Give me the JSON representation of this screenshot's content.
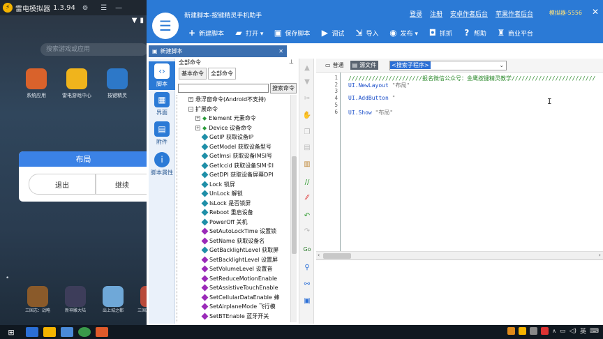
{
  "emulator": {
    "title": "雷电模拟器",
    "version": "1.3.94",
    "search_placeholder": "搜索游戏或应用",
    "apps": [
      {
        "label": "系统应用",
        "color": "#d9622b"
      },
      {
        "label": "雷电游戏中心",
        "color": "#f0b41c"
      },
      {
        "label": "按键精灵",
        "color": "#2d78c8"
      }
    ],
    "dialog": {
      "title": "布局",
      "left_button": "退出",
      "right_button": "继续"
    },
    "dock": [
      {
        "label": "三国志：战略",
        "color": "#8a5a2a"
      },
      {
        "label": "新神雕大陆",
        "color": "#3d3d5a"
      },
      {
        "label": "出上城之都",
        "color": "#6fa8d8"
      },
      {
        "label": "三国志:乱世之群大",
        "color": "#b84a3a"
      }
    ]
  },
  "ide": {
    "title": "新建脚本-按键精灵手机助手",
    "links": [
      "登录",
      "注册",
      "安卓作者后台",
      "苹果作者后台"
    ],
    "user": "模拟器-5556",
    "toolbar": [
      {
        "icon": "plus-icon",
        "glyph": "+",
        "label": "新建脚本"
      },
      {
        "icon": "folder-icon",
        "glyph": "▰",
        "label": "打开 ▾"
      },
      {
        "icon": "save-icon",
        "glyph": "▣",
        "label": "保存脚本"
      },
      {
        "icon": "play-icon",
        "glyph": "▶",
        "label": "调试"
      },
      {
        "icon": "import-icon",
        "glyph": "⇲",
        "label": "导入"
      },
      {
        "icon": "publish-icon",
        "glyph": "◉",
        "label": "发布 ▾"
      },
      {
        "icon": "camera-icon",
        "glyph": "◘",
        "label": "抓抓"
      },
      {
        "icon": "help-icon",
        "glyph": "?",
        "label": "帮助"
      },
      {
        "icon": "shop-icon",
        "glyph": "♜",
        "label": "商业平台"
      }
    ],
    "tab": "新建脚本",
    "side_items": [
      {
        "label": "脚本",
        "icon": "script-icon",
        "color": "#2b7ad6"
      },
      {
        "label": "界面",
        "icon": "ui-icon",
        "color": "#2b7ad6"
      },
      {
        "label": "附件",
        "icon": "attachment-icon",
        "color": "#2b7ad6"
      },
      {
        "label": "脚本属性",
        "icon": "info-icon",
        "color": "#2b7ad6"
      }
    ],
    "cmd": {
      "header": "全部命令",
      "tabs": [
        "基本命令",
        "全部命令"
      ],
      "search_button": "搜索命令",
      "tree": [
        {
          "label": "悬浮窗命令(Android不支持)",
          "indent": 1,
          "kind": "node"
        },
        {
          "label": "扩展命令",
          "indent": 1,
          "kind": "node"
        },
        {
          "label": "Element 元素命令",
          "indent": 2,
          "kind": "group"
        },
        {
          "label": "Device 设备命令",
          "indent": 2,
          "kind": "group"
        },
        {
          "label": "GetIP 获取设备IP",
          "indent": 3,
          "kind": "leaf"
        },
        {
          "label": "GetModel 获取设备型号",
          "indent": 3,
          "kind": "leaf"
        },
        {
          "label": "GetImsi 获取设备IMSI号",
          "indent": 3,
          "kind": "leaf"
        },
        {
          "label": "GetIccid 获取设备SIM卡I",
          "indent": 3,
          "kind": "leaf"
        },
        {
          "label": "GetDPI 获取设备屏幕DPI",
          "indent": 3,
          "kind": "leaf"
        },
        {
          "label": "Lock 锁屏",
          "indent": 3,
          "kind": "leaf"
        },
        {
          "label": "UnLock 解锁",
          "indent": 3,
          "kind": "leaf"
        },
        {
          "label": "IsLock 是否锁屏",
          "indent": 3,
          "kind": "leaf"
        },
        {
          "label": "Reboot 重启设备",
          "indent": 3,
          "kind": "leaf"
        },
        {
          "label": "PowerOff 关机",
          "indent": 3,
          "kind": "leaf"
        },
        {
          "label": "SetAutoLockTime 设置锁",
          "indent": 3,
          "kind": "leaf2"
        },
        {
          "label": "SetName 获取设备名",
          "indent": 3,
          "kind": "leaf2"
        },
        {
          "label": "GetBacklightLevel 获取屏",
          "indent": 3,
          "kind": "leaf"
        },
        {
          "label": "SetBacklightLevel 设置屏",
          "indent": 3,
          "kind": "leaf2"
        },
        {
          "label": "SetVolumeLevel 设置音",
          "indent": 3,
          "kind": "leaf2"
        },
        {
          "label": "SetReduceMotionEnable",
          "indent": 3,
          "kind": "leaf2"
        },
        {
          "label": "SetAssistiveTouchEnable",
          "indent": 3,
          "kind": "leaf2"
        },
        {
          "label": "SetCellularDataEnable 蜂",
          "indent": 3,
          "kind": "leaf2"
        },
        {
          "label": "SetAirplaneMode 飞行模",
          "indent": 3,
          "kind": "leaf2"
        },
        {
          "label": "SetBTEnable 蓝牙开关",
          "indent": 3,
          "kind": "leaf2"
        }
      ]
    },
    "editor": {
      "tabs": [
        "普通",
        "源文件"
      ],
      "nav_select": "<搜索子程序>",
      "lines": [
        {
          "n": "1",
          "parts": [
            {
              "t": "//////////////////////报名微信公众号：金鹰按键精灵教学/////////////////////////",
              "c": "cm"
            }
          ]
        },
        {
          "n": "2",
          "parts": [
            {
              "t": "UI.NewLayout ",
              "c": "kw"
            },
            {
              "t": "\"布局\"",
              "c": "st"
            }
          ]
        },
        {
          "n": "3",
          "parts": []
        },
        {
          "n": "4",
          "parts": [
            {
              "t": "UI.AddButton ",
              "c": "kw"
            },
            {
              "t": "\"",
              "c": "st"
            }
          ]
        },
        {
          "n": "5",
          "parts": []
        },
        {
          "n": "6",
          "parts": [
            {
              "t": "UI.Show ",
              "c": "kw"
            },
            {
              "t": "\"布局\"",
              "c": "st"
            }
          ]
        }
      ]
    }
  },
  "taskbar": {
    "tray_ime": "英",
    "apps": [
      "windows",
      "task",
      "emulator",
      "chrome",
      "keysprite",
      "browser"
    ]
  }
}
